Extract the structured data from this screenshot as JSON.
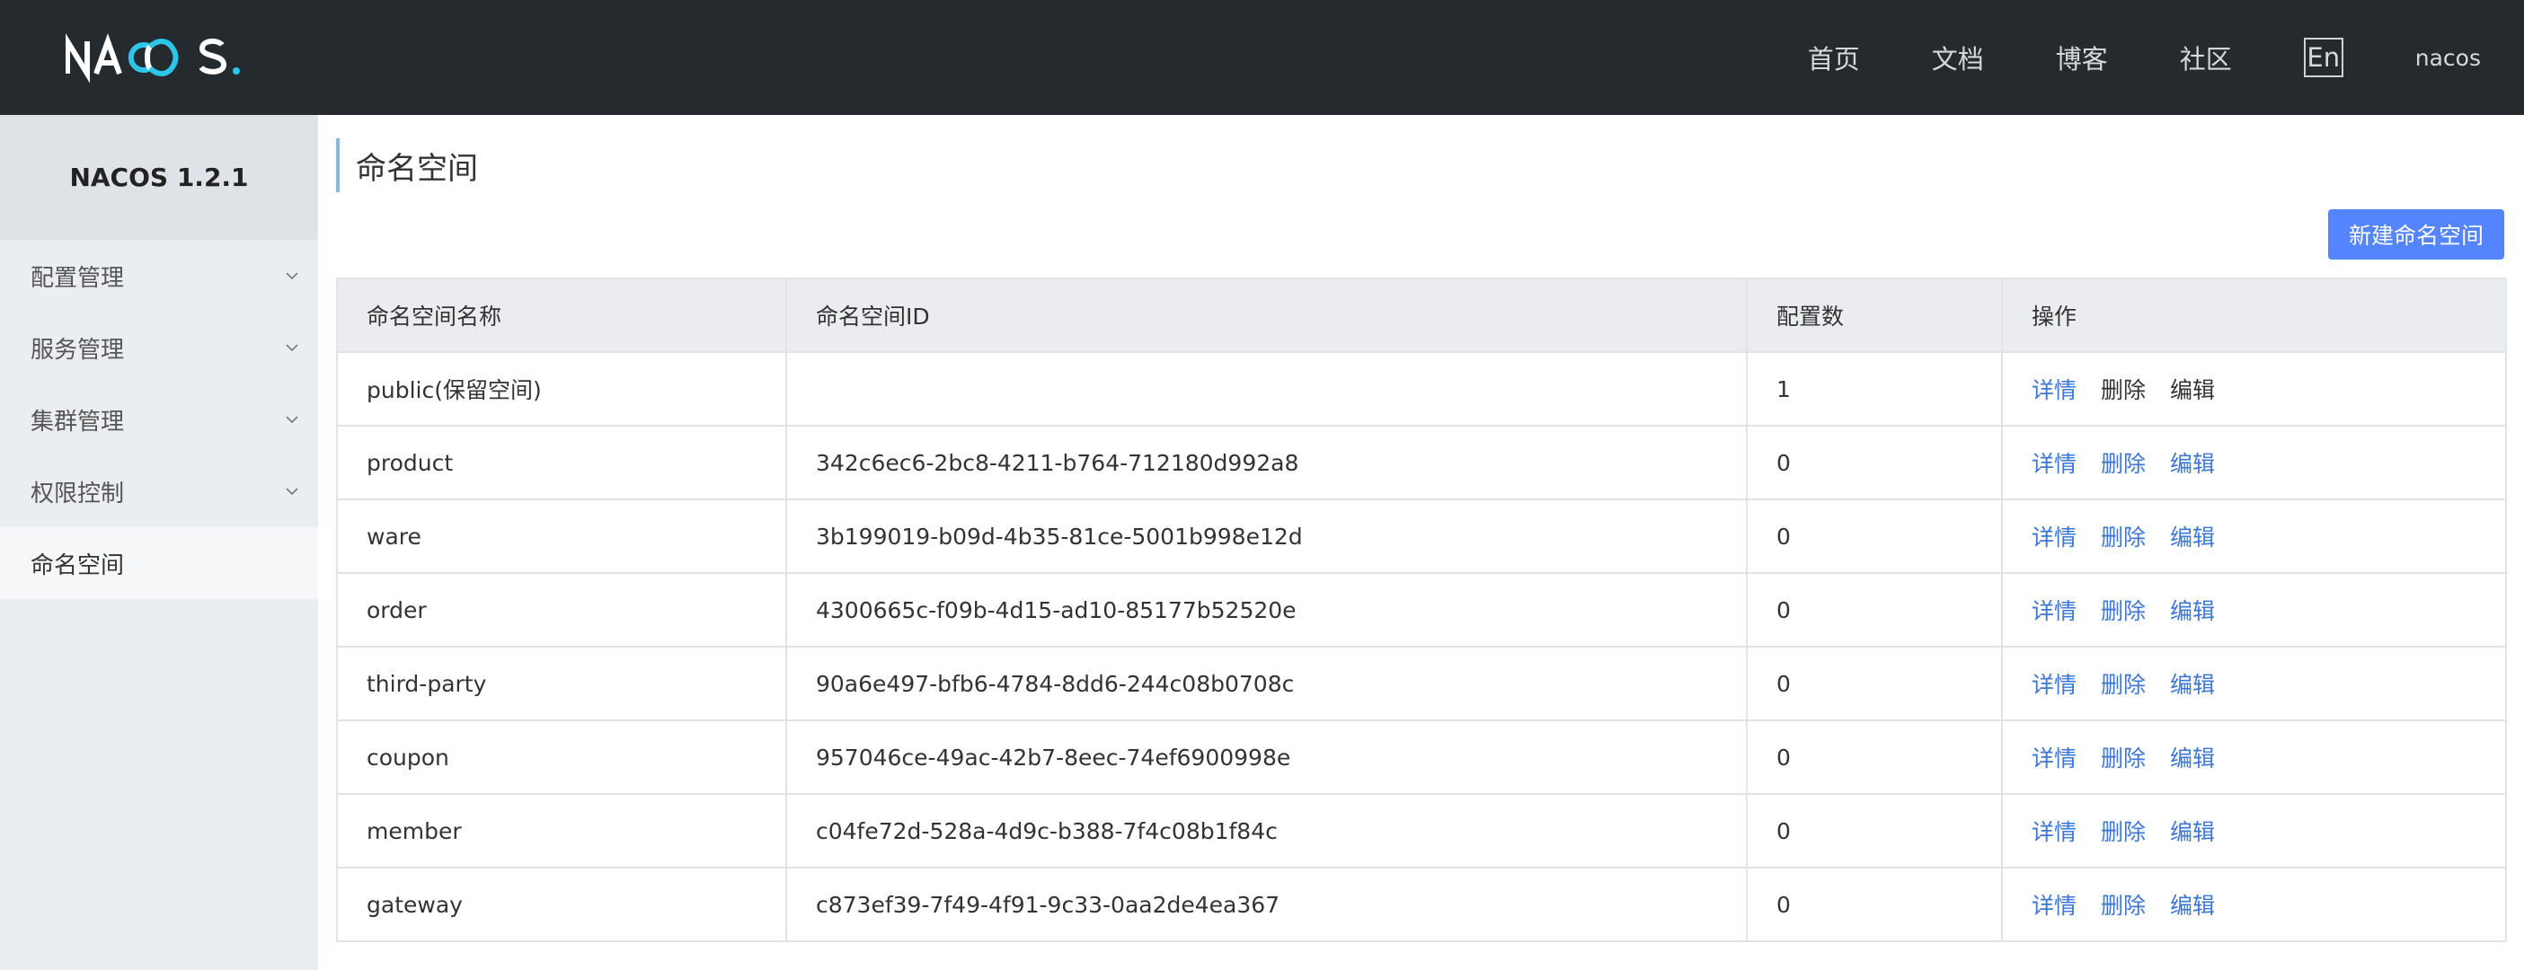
{
  "header": {
    "logo_text": "NACOS.",
    "nav": [
      "首页",
      "文档",
      "博客",
      "社区"
    ],
    "lang_button": "En",
    "user": "nacos"
  },
  "sidebar": {
    "version": "NACOS 1.2.1",
    "items": [
      {
        "label": "配置管理",
        "icon": "chevron-down-icon"
      },
      {
        "label": "服务管理",
        "icon": "chevron-down-icon"
      },
      {
        "label": "集群管理",
        "icon": "chevron-down-icon"
      },
      {
        "label": "权限控制",
        "icon": "chevron-down-icon"
      },
      {
        "label": "命名空间",
        "active": true
      }
    ]
  },
  "main": {
    "title": "命名空间",
    "create_button": "新建命名空间",
    "table": {
      "columns": [
        "命名空间名称",
        "命名空间ID",
        "配置数",
        "操作"
      ],
      "actions": [
        "详情",
        "删除",
        "编辑"
      ],
      "rows": [
        {
          "name": "public(保留空间)",
          "id": "",
          "count": "1",
          "editable": false
        },
        {
          "name": "product",
          "id": "342c6ec6-2bc8-4211-b764-712180d992a8",
          "count": "0",
          "editable": true
        },
        {
          "name": "ware",
          "id": "3b199019-b09d-4b35-81ce-5001b998e12d",
          "count": "0",
          "editable": true
        },
        {
          "name": "order",
          "id": "4300665c-f09b-4d15-ad10-85177b52520e",
          "count": "0",
          "editable": true
        },
        {
          "name": "third-party",
          "id": "90a6e497-bfb6-4784-8dd6-244c08b0708c",
          "count": "0",
          "editable": true
        },
        {
          "name": "coupon",
          "id": "957046ce-49ac-42b7-8eec-74ef6900998e",
          "count": "0",
          "editable": true
        },
        {
          "name": "member",
          "id": "c04fe72d-528a-4d9c-b388-7f4c08b1f84c",
          "count": "0",
          "editable": true
        },
        {
          "name": "gateway",
          "id": "c873ef39-7f49-4f91-9c33-0aa2de4ea367",
          "count": "0",
          "editable": true
        }
      ]
    }
  },
  "colors": {
    "header_bg": "#252a2f",
    "sidebar_bg": "#eaedf1",
    "primary": "#5584ff",
    "link": "#3c76d6",
    "logo_accent": "#2ec6e8"
  }
}
